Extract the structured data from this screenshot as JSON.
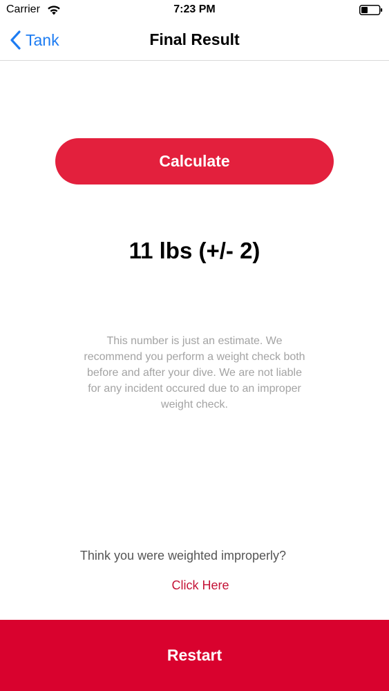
{
  "status_bar": {
    "carrier": "Carrier",
    "time": "7:23 PM",
    "wifi_icon": "wifi-icon",
    "battery_icon": "battery-icon"
  },
  "nav": {
    "back_label": "Tank",
    "back_icon": "chevron-left-icon",
    "title": "Final Result"
  },
  "main": {
    "calculate_label": "Calculate",
    "result": "11 lbs (+/- 2)",
    "disclaimer": "This number is just an estimate. We recommend you perform a weight check both before and after your dive. We are not liable for any incident occured due to an improper weight check.",
    "improper_prompt": "Think you were weighted improperly?",
    "click_here_label": "Click Here"
  },
  "footer": {
    "restart_label": "Restart"
  },
  "colors": {
    "accent_blue": "#1d7cf2",
    "calculate_red": "#e3203d",
    "restart_red": "#d9022e",
    "link_red": "#c41236",
    "disclaimer_gray": "#a3a3a3"
  }
}
